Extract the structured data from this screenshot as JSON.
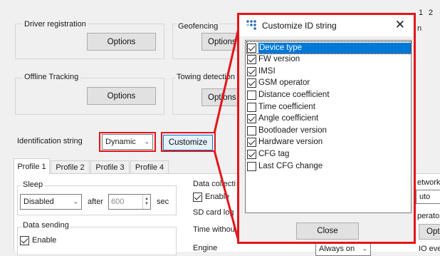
{
  "main": {
    "groups": [
      {
        "label": "Driver registration",
        "button": "Options"
      },
      {
        "label": "Geofencing",
        "button": "Options"
      },
      {
        "label": "Offline Tracking",
        "button": "Options"
      },
      {
        "label": "Towing detection",
        "button": "Options"
      }
    ],
    "top_right_numbers": [
      "1",
      "2"
    ],
    "top_right_letter": "n",
    "identification": {
      "label": "Identification string",
      "value": "Dynamic",
      "customize": "Customize"
    },
    "tabs": [
      "Profile 1",
      "Profile 2",
      "Profile 3",
      "Profile 4"
    ],
    "sleep": {
      "label": "Sleep",
      "mode": "Disabled",
      "after": "after",
      "value": "600",
      "unit": "sec"
    },
    "data_sending": {
      "label": "Data sending",
      "enable": "Enable"
    },
    "data_collection": {
      "label": "Data collecti",
      "enable": "Enable",
      "sd_card": "SD card log",
      "time_without": "Time withou",
      "engine": "Engine",
      "engine_value": "Always on"
    },
    "right_col": {
      "network": "etwork",
      "network_value": "uto",
      "operator": "perator",
      "operator_btn": "Opti",
      "io": "IO events"
    }
  },
  "dialog": {
    "title": "Customize ID string",
    "close_label": "Close",
    "items": [
      {
        "label": "Device type",
        "checked": true,
        "selected": true
      },
      {
        "label": "FW version",
        "checked": true
      },
      {
        "label": "IMSI",
        "checked": true
      },
      {
        "label": "GSM operator",
        "checked": true
      },
      {
        "label": "Distance coefficient",
        "checked": false
      },
      {
        "label": "Time coefficient",
        "checked": false
      },
      {
        "label": "Angle coefficient",
        "checked": true
      },
      {
        "label": "Bootloader version",
        "checked": false
      },
      {
        "label": "Hardware version",
        "checked": true
      },
      {
        "label": "CFG tag",
        "checked": true
      },
      {
        "label": "Last CFG change",
        "checked": false
      }
    ]
  },
  "colors": {
    "highlight": "#e3151a",
    "selection": "#0078d7"
  }
}
